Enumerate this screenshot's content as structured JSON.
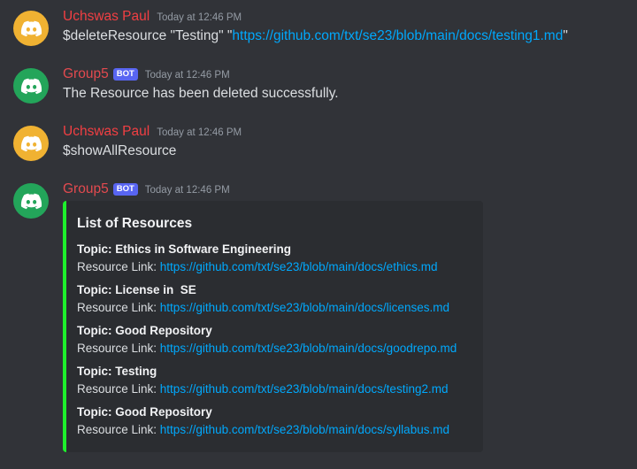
{
  "colors": {
    "background": "#313338",
    "embed_background": "#2b2d31",
    "embed_accent": "#1ef02c",
    "username": "#f23f43",
    "link": "#00a8fc",
    "bot_tag": "#5865f2",
    "avatar_user": "#f0b232",
    "avatar_bot": "#23a55a"
  },
  "messages": [
    {
      "author": "Uchswas Paul",
      "timestamp": "Today at 12:46 PM",
      "avatar_icon": "discord-logo-icon",
      "content_prefix": "$deleteResource \"Testing\" \"",
      "content_link": "https://github.com/txt/se23/blob/main/docs/testing1.md",
      "content_suffix": "\""
    },
    {
      "author": "Group5",
      "bot_tag": "BOT",
      "timestamp": "Today at 12:46 PM",
      "avatar_icon": "discord-logo-icon",
      "content": "The Resource has been deleted successfully."
    },
    {
      "author": "Uchswas Paul",
      "timestamp": "Today at 12:46 PM",
      "avatar_icon": "discord-logo-icon",
      "content": "$showAllResource"
    },
    {
      "author": "Group5",
      "bot_tag": "BOT",
      "timestamp": "Today at 12:46 PM",
      "avatar_icon": "discord-logo-icon",
      "embed": {
        "title": "List of Resources",
        "link_label": "Resource Link: ",
        "fields": [
          {
            "topic": "Topic: Ethics in Software Engineering",
            "link": "https://github.com/txt/se23/blob/main/docs/ethics.md"
          },
          {
            "topic": "Topic: License in  SE",
            "link": "https://github.com/txt/se23/blob/main/docs/licenses.md"
          },
          {
            "topic": "Topic: Good Repository",
            "link": "https://github.com/txt/se23/blob/main/docs/goodrepo.md"
          },
          {
            "topic": "Topic: Testing",
            "link": "https://github.com/txt/se23/blob/main/docs/testing2.md"
          },
          {
            "topic": "Topic: Good Repository",
            "link": "https://github.com/txt/se23/blob/main/docs/syllabus.md"
          }
        ]
      }
    }
  ]
}
